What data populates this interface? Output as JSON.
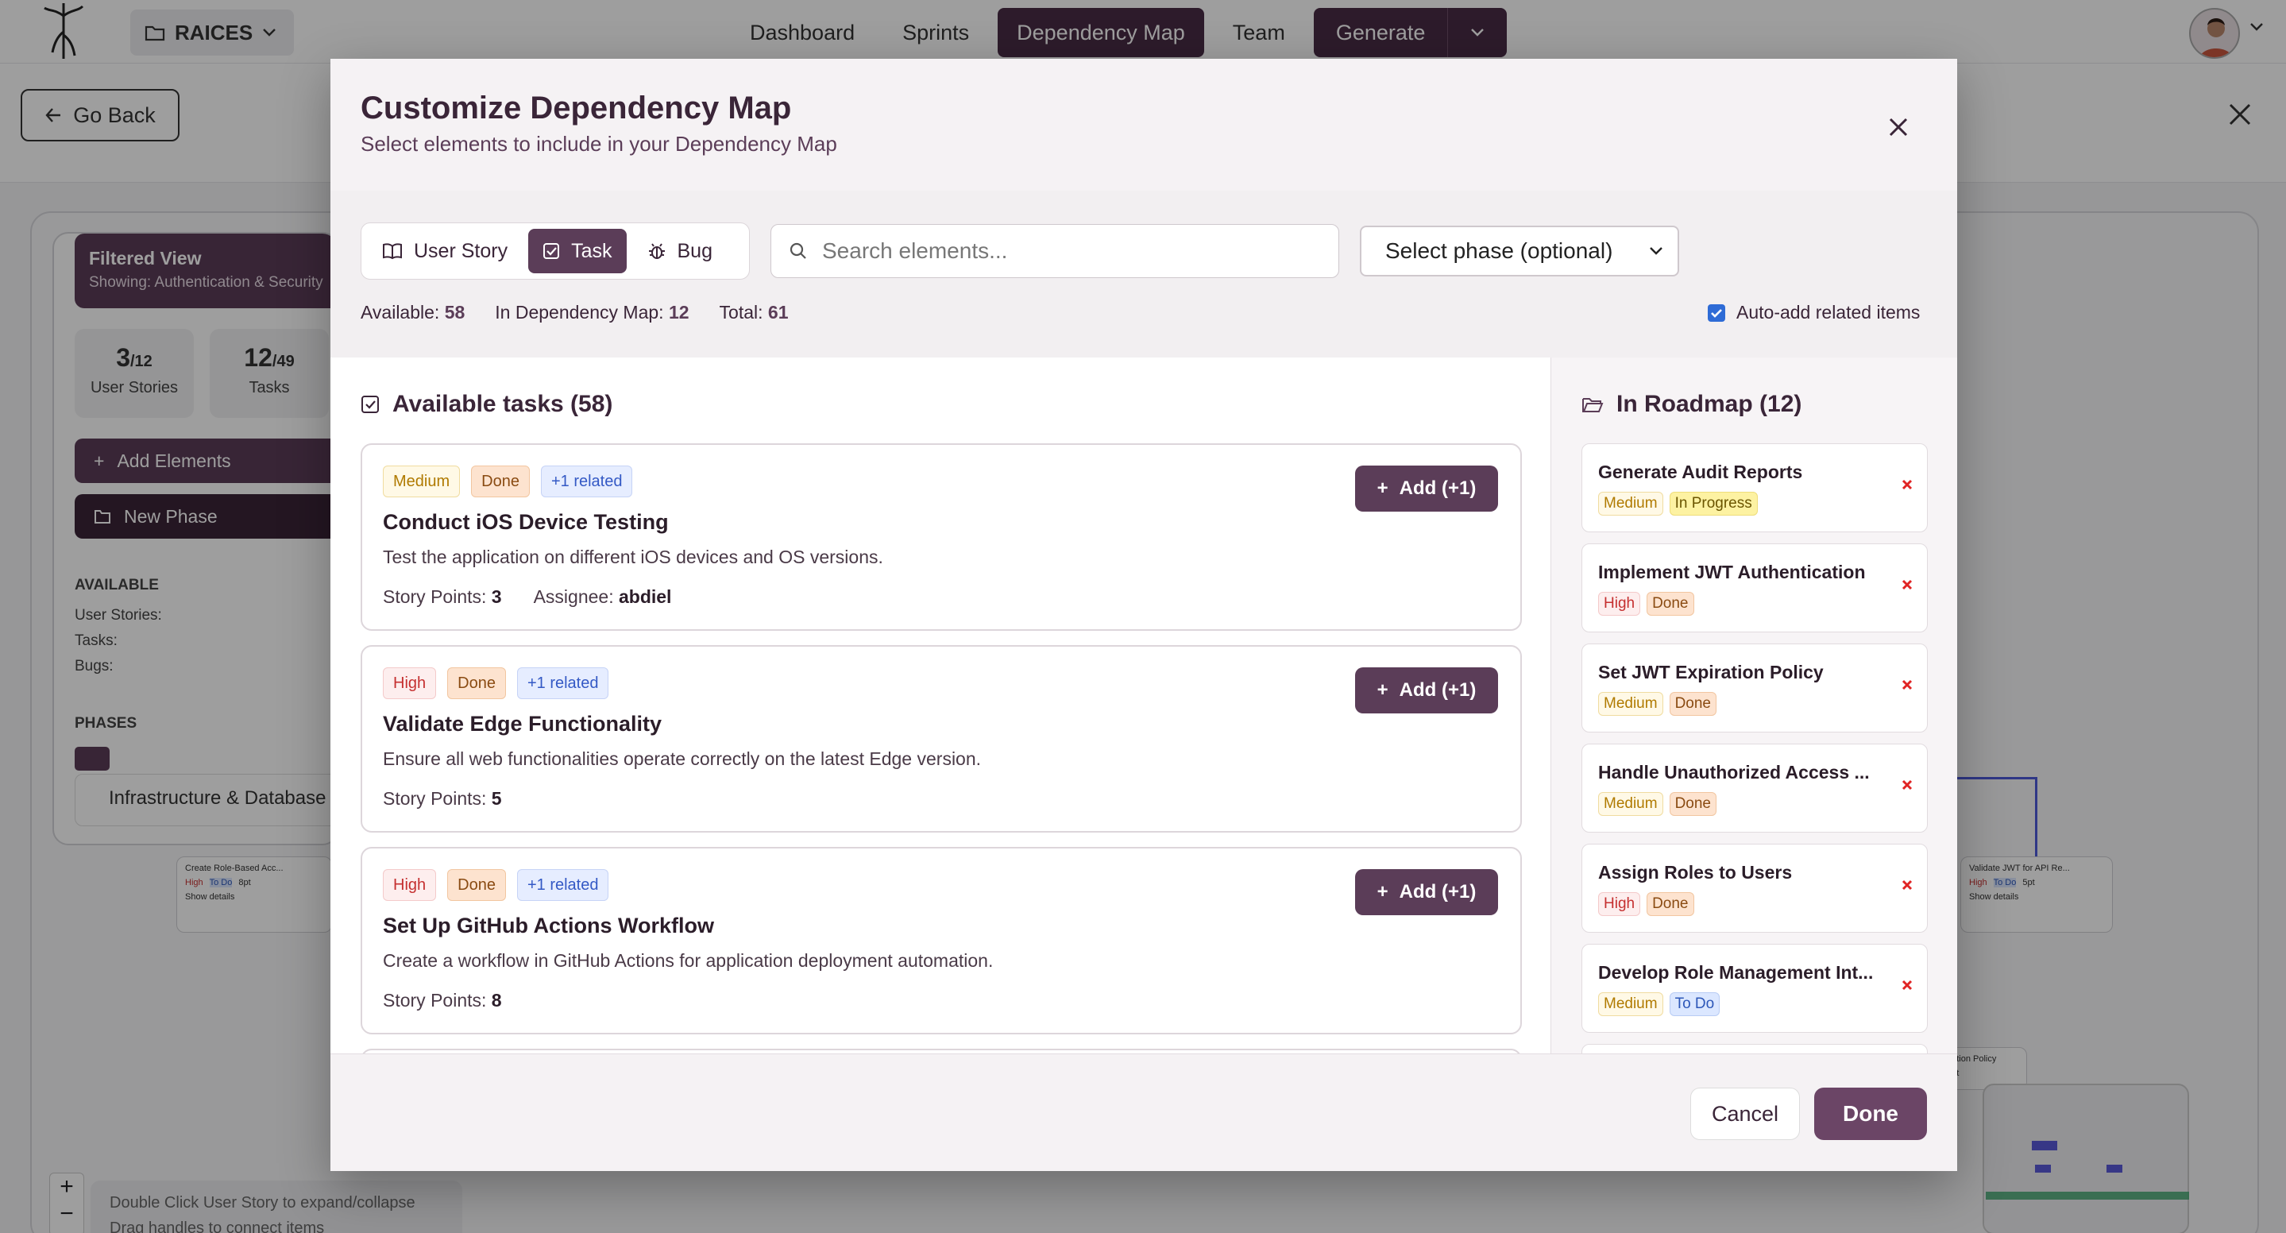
{
  "app": {
    "project_name": "RAICES",
    "nav": [
      "Dashboard",
      "Sprints",
      "Dependency Map",
      "Team"
    ],
    "generate_label": "Generate",
    "go_back_label": "Go Back"
  },
  "sidepanel": {
    "filtered_title": "Filtered View",
    "filtered_sub": "Showing: Authentication & Security",
    "stats": [
      {
        "num": "3",
        "den": "/12",
        "label": "User Stories"
      },
      {
        "num": "12",
        "den": "/49",
        "label": "Tasks"
      }
    ],
    "add_elements_label": "Add Elements",
    "new_phase_label": "New Phase",
    "available_heading": "AVAILABLE",
    "available_rows": [
      "User Stories:",
      "Tasks:",
      "Bugs:"
    ],
    "phases_heading": "PHASES",
    "phase_name": "Infrastructure & Database"
  },
  "canvas": {
    "mini_nodes": [
      {
        "title": "Create Role-Based Acc...",
        "priority": "High",
        "status": "To Do",
        "points": "8pt",
        "link": "Show details"
      },
      {
        "title": "Validate JWT for API Re...",
        "priority": "High",
        "status": "To Do",
        "points": "5pt",
        "link": "Show details"
      },
      {
        "title": "iration Policy",
        "points": "3pt"
      }
    ],
    "hint_lines": [
      "Double Click User Story to expand/collapse",
      "Drag handles to connect items"
    ],
    "zoom_in": "+",
    "zoom_out": "−"
  },
  "modal": {
    "title": "Customize Dependency Map",
    "subtitle": "Select elements to include in your Dependency Map",
    "type_tabs": [
      {
        "label": "User Story",
        "icon": "book-icon",
        "active": false
      },
      {
        "label": "Task",
        "icon": "checkbox-icon",
        "active": true
      },
      {
        "label": "Bug",
        "icon": "bug-icon",
        "active": false
      }
    ],
    "search_placeholder": "Search elements...",
    "phase_select_label": "Select phase (optional)",
    "counts": {
      "available_label": "Available:",
      "available": "58",
      "in_map_label": "In Dependency Map:",
      "in_map": "12",
      "total_label": "Total:",
      "total": "61"
    },
    "auto_add_label": "Auto-add related items",
    "auto_add_checked": true,
    "available_title": "Available tasks (58)",
    "tasks": [
      {
        "priority": "Medium",
        "status": "Done",
        "related": "+1 related",
        "title": "Conduct iOS Device Testing",
        "description": "Test the application on different iOS devices and OS versions.",
        "points_label": "Story Points:",
        "points": "3",
        "assignee_label": "Assignee:",
        "assignee": "abdiel",
        "add_label": "Add (+1)"
      },
      {
        "priority": "High",
        "status": "Done",
        "related": "+1 related",
        "title": "Validate Edge Functionality",
        "description": "Ensure all web functionalities operate correctly on the latest Edge version.",
        "points_label": "Story Points:",
        "points": "5",
        "add_label": "Add (+1)"
      },
      {
        "priority": "High",
        "status": "Done",
        "related": "+1 related",
        "title": "Set Up GitHub Actions Workflow",
        "description": "Create a workflow in GitHub Actions for application deployment automation.",
        "points_label": "Story Points:",
        "points": "8",
        "add_label": "Add (+1)"
      }
    ],
    "roadmap_title": "In Roadmap (12)",
    "roadmap": [
      {
        "title": "Generate Audit Reports",
        "priority": "Medium",
        "status": "In Progress"
      },
      {
        "title": "Implement JWT Authentication",
        "priority": "High",
        "status": "Done"
      },
      {
        "title": "Set JWT Expiration Policy",
        "priority": "Medium",
        "status": "Done"
      },
      {
        "title": "Handle Unauthorized Access ...",
        "priority": "Medium",
        "status": "Done"
      },
      {
        "title": "Assign Roles to Users",
        "priority": "High",
        "status": "Done"
      },
      {
        "title": "Develop Role Management Int...",
        "priority": "Medium",
        "status": "To Do"
      }
    ],
    "cancel_label": "Cancel",
    "done_label": "Done"
  },
  "colors": {
    "primary": "#5b3d58",
    "nav_active": "#4a2d46",
    "remove": "#e02424"
  }
}
